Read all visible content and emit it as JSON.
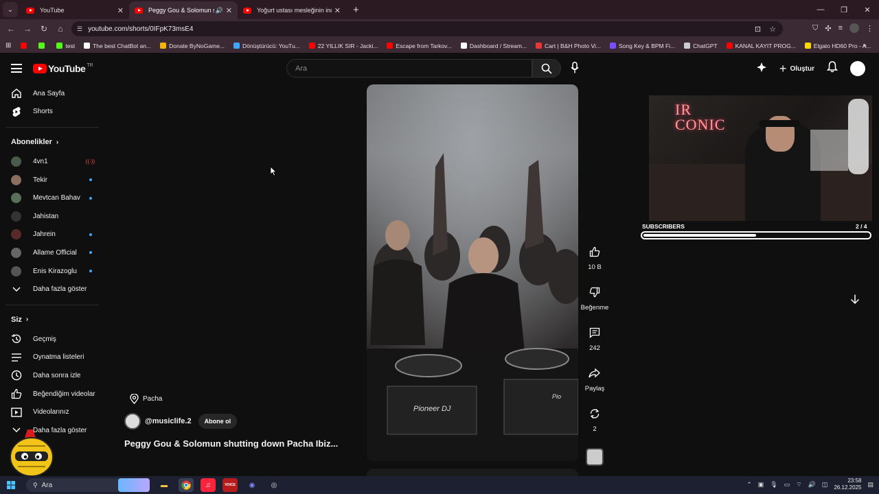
{
  "browser": {
    "tabs": [
      {
        "title": "YouTube",
        "active": false
      },
      {
        "title": "Peggy Gou & Solomun shu",
        "active": true
      },
      {
        "title": "Yoğurt ustası mesleğinin inceli",
        "active": false
      }
    ],
    "url": "youtube.com/shorts/0IFpK73msE4",
    "bookmarks": [
      {
        "label": "",
        "color": "#ff0000"
      },
      {
        "label": "",
        "color": "#53fc18"
      },
      {
        "label": "test",
        "color": "#53fc18"
      },
      {
        "label": "The best ChatBot an...",
        "color": "#ffffff"
      },
      {
        "label": "Donate ByNoGame...",
        "color": "#f5b400"
      },
      {
        "label": "Dönüştürücü: YouTu...",
        "color": "#3ea6ff"
      },
      {
        "label": "22 YILLIK SIR - Jacki...",
        "color": "#ff0000"
      },
      {
        "label": "Escape from Tarkov...",
        "color": "#ff0000"
      },
      {
        "label": "Dashboard / Stream...",
        "color": "#ffffff"
      },
      {
        "label": "Cart | B&H Photo Vi...",
        "color": "#e53935"
      },
      {
        "label": "Song Key & BPM Fi...",
        "color": "#7c4dff"
      },
      {
        "label": "ChatGPT",
        "color": "#cccccc"
      },
      {
        "label": "KANAL KAYIT PROG...",
        "color": "#ff0000"
      },
      {
        "label": "Elgato HD60 Pro - A...",
        "color": "#ffd600"
      }
    ]
  },
  "header": {
    "logo": "YouTube",
    "country": "TR",
    "search_placeholder": "Ara",
    "create_label": "Oluştur"
  },
  "sidebar": {
    "main": [
      {
        "label": "Ana Sayfa",
        "icon": "home-icon"
      },
      {
        "label": "Shorts",
        "icon": "shorts-icon"
      }
    ],
    "subscriptions_title": "Abonelikler",
    "subscriptions": [
      {
        "label": "4vn1",
        "status": "live",
        "live_glyph": "((·))"
      },
      {
        "label": "Tekir",
        "status": "new"
      },
      {
        "label": "Mevtcan Bahav",
        "status": "new"
      },
      {
        "label": "Jahistan",
        "status": ""
      },
      {
        "label": "Jahrein",
        "status": "new"
      },
      {
        "label": "Allame Official",
        "status": "new"
      },
      {
        "label": "Enis Kirazoglu",
        "status": "new"
      }
    ],
    "show_more": "Daha fazla göster",
    "you_title": "Siz",
    "you_items": [
      {
        "label": "Geçmiş",
        "icon": "history-icon"
      },
      {
        "label": "Oynatma listeleri",
        "icon": "playlists-icon"
      },
      {
        "label": "Daha sonra izle",
        "icon": "watch-later-icon"
      },
      {
        "label": "Beğendiğim videolar",
        "icon": "like-icon"
      },
      {
        "label": "Videolarınız",
        "icon": "your-videos-icon"
      }
    ],
    "show_more_2": "Daha fazla göster"
  },
  "short": {
    "location": "Pacha",
    "channel": "@musiclife.2",
    "subscribe": "Abone ol",
    "title": "Peggy Gou & Solomun shutting down Pacha Ibiz...",
    "likes": "10 B",
    "dislike_label": "Beğenme",
    "comments": "242",
    "share_label": "Paylaş",
    "remix_count": "2"
  },
  "overlay": {
    "neon_line1": "IR",
    "neon_line2": "CONIC",
    "subscribers_label": "SUBSCRIBERS",
    "subscribers_count": "2 / 4",
    "progress_fraction": 0.5
  },
  "taskbar": {
    "search_label": "Ara",
    "time": "23:58",
    "date": "26.12.2025"
  }
}
